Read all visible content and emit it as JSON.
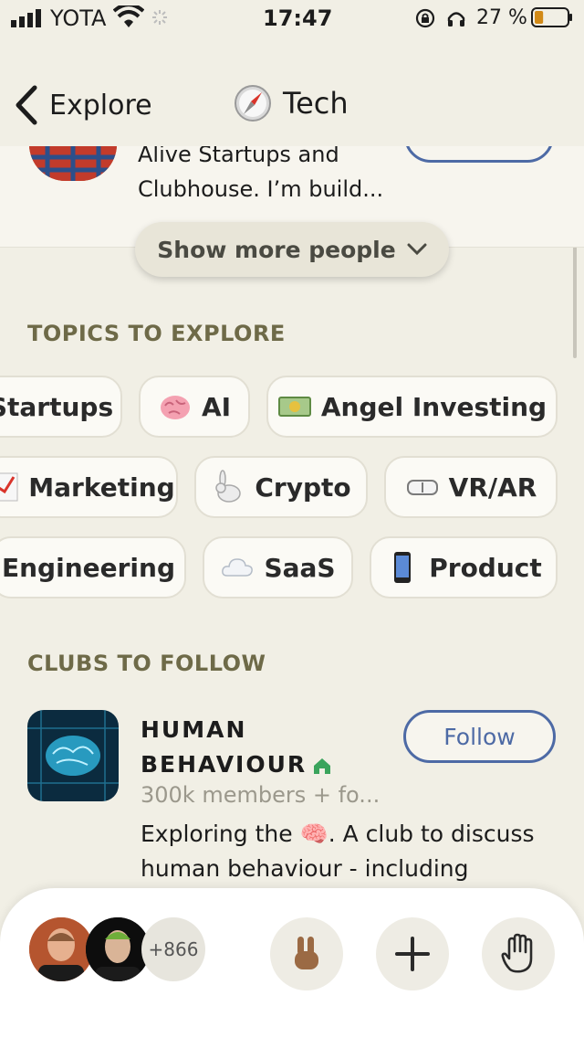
{
  "status_bar": {
    "carrier": "YOTA",
    "time": "17:47",
    "battery": "27 %",
    "battery_level": 0.27
  },
  "nav": {
    "back_label": "Explore",
    "title": "Tech",
    "title_icon": "compass-icon"
  },
  "person": {
    "bio_line1": "Alive Startups and",
    "bio_line2": "Clubhouse. I’m build..."
  },
  "show_more": {
    "label": "Show more people"
  },
  "topics": {
    "title": "TOPICS TO EXPLORE",
    "rows": [
      [
        {
          "icon": "",
          "label": "Startups"
        },
        {
          "icon": "brain-icon",
          "label": "AI"
        },
        {
          "icon": "money-icon",
          "label": "Angel Investing"
        }
      ],
      [
        {
          "icon": "chart-icon",
          "label": "Marketing"
        },
        {
          "icon": "rabbit-icon",
          "label": "Crypto"
        },
        {
          "icon": "goggles-icon",
          "label": "VR/AR"
        }
      ],
      [
        {
          "icon": "",
          "label": "Engineering"
        },
        {
          "icon": "cloud-icon",
          "label": "SaaS"
        },
        {
          "icon": "phone-icon",
          "label": "Product"
        }
      ]
    ]
  },
  "clubs": {
    "title": "CLUBS TO FOLLOW",
    "items": [
      {
        "name_line1": "HUMAN",
        "name_line2": "BEHAVIOUR",
        "meta": "300k members + fo...",
        "desc_line1": "Exploring the 🧠. A club to discuss",
        "desc_line2": "human behaviour -  including",
        "follow_label": "Follow"
      }
    ]
  },
  "bottom_bar": {
    "more_count": "+866"
  },
  "colors": {
    "background": "#f1efe5",
    "accent_blue": "#4d6aa5",
    "section_title": "#6e6a48",
    "club_home": "#3aa45c"
  }
}
